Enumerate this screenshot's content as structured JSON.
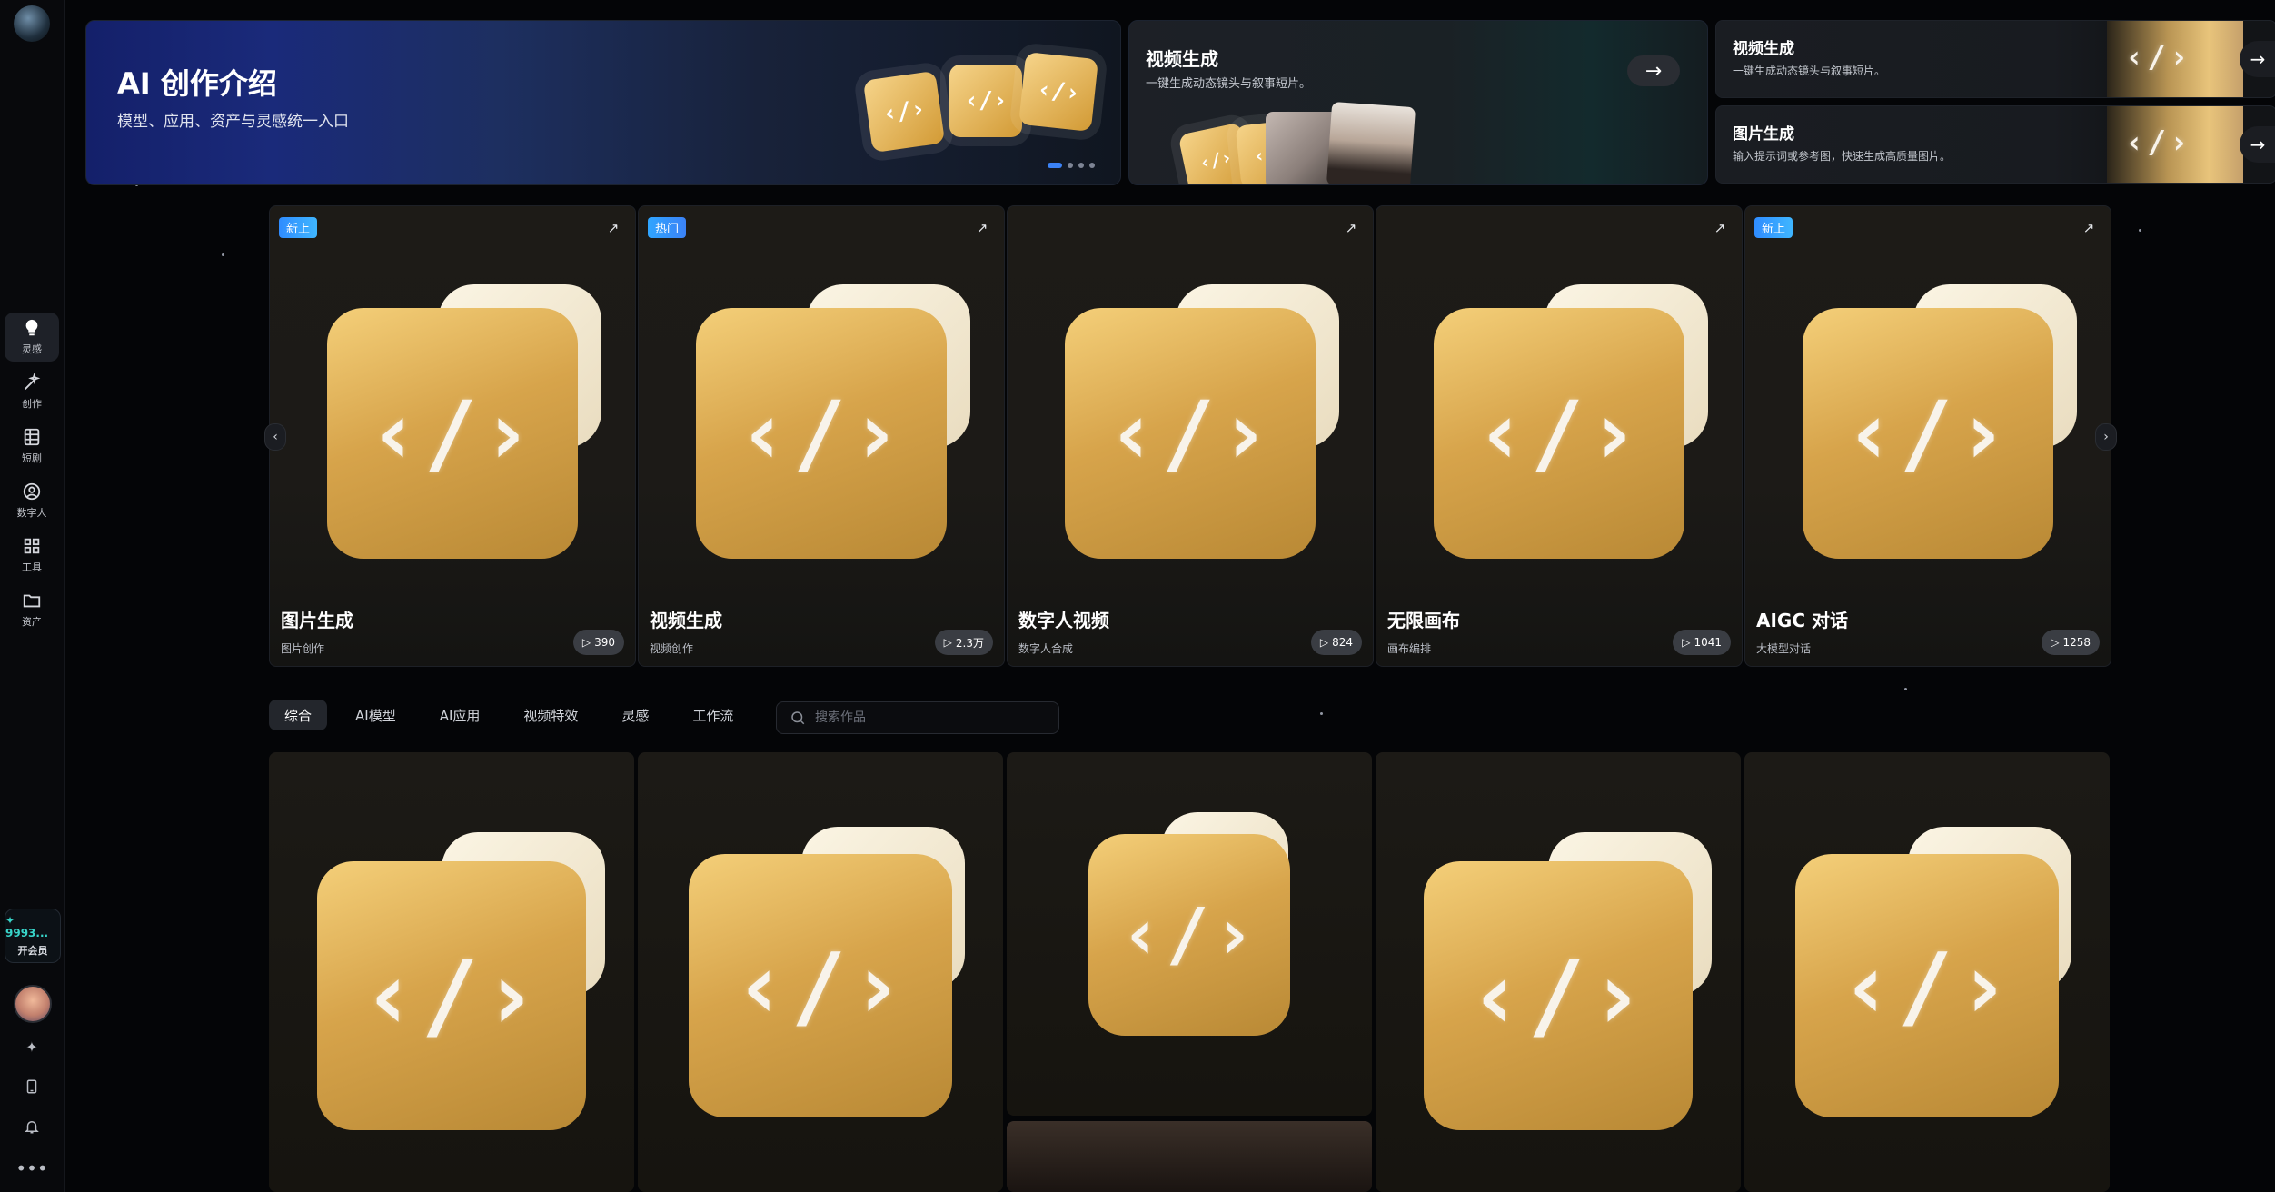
{
  "sidebar": {
    "logo_text": "",
    "items": [
      {
        "label": "灵感",
        "icon": "bulb-icon"
      },
      {
        "label": "创作",
        "icon": "magic-wand-icon"
      },
      {
        "label": "短剧",
        "icon": "film-icon"
      },
      {
        "label": "数字人",
        "icon": "person-icon"
      },
      {
        "label": "工具",
        "icon": "grid-icon"
      },
      {
        "label": "资产",
        "icon": "folder-icon"
      }
    ],
    "credits": {
      "amount": "9993...",
      "vip": "开会员"
    },
    "bottom_icons": [
      "sparkle-icon",
      "phone-icon",
      "bell-icon",
      "more-icon"
    ]
  },
  "hero": {
    "title": "AI 创作介绍",
    "subtitle": "模型、应用、资产与灵感统一入口"
  },
  "video_card": {
    "title": "视频生成",
    "subtitle": "一键生成动态镜头与叙事短片。"
  },
  "side_cards": [
    {
      "title": "视频生成",
      "subtitle": "一键生成动态镜头与叙事短片。"
    },
    {
      "title": "图片生成",
      "subtitle": "输入提示词或参考图，快速生成高质量图片。"
    }
  ],
  "featured": [
    {
      "badge": "新上",
      "title": "图片生成",
      "sub": "图片创作",
      "plays": "390"
    },
    {
      "badge": "热门",
      "title": "视频生成",
      "sub": "视频创作",
      "plays": "2.3万"
    },
    {
      "badge": "",
      "title": "数字人视频",
      "sub": "数字人合成",
      "plays": "824"
    },
    {
      "badge": "",
      "title": "无限画布",
      "sub": "画布编排",
      "plays": "1041"
    },
    {
      "badge": "新上",
      "title": "AIGC 对话",
      "sub": "大模型对话",
      "plays": "1258"
    }
  ],
  "tabs": [
    "综合",
    "AI模型",
    "AI应用",
    "视频特效",
    "灵感",
    "工作流"
  ],
  "search": {
    "placeholder": "搜索作品"
  },
  "colors": {
    "accent": "#3b82f6",
    "credit": "#38d4c9",
    "tile": "#d7a44b"
  }
}
